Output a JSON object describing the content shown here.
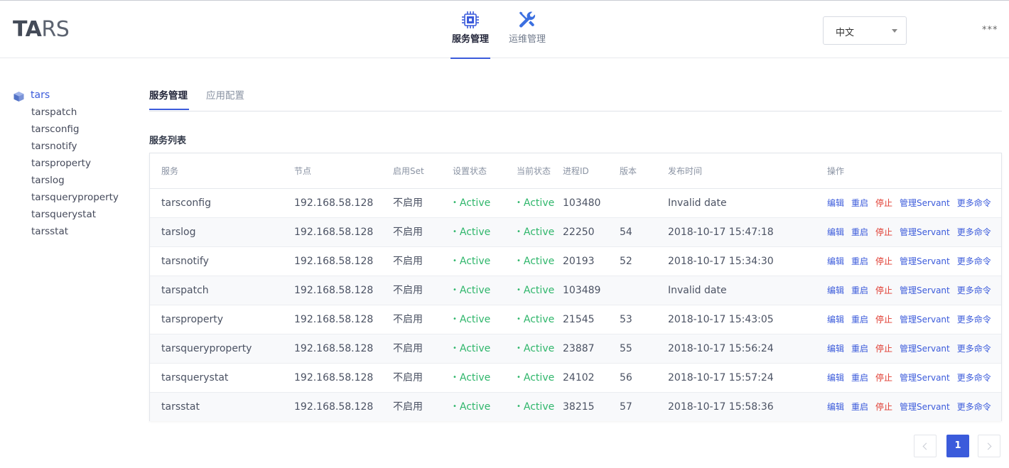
{
  "header": {
    "logo_bold": "TA",
    "logo_light": "RS",
    "nav": [
      {
        "label": "服务管理",
        "icon": "chip-icon",
        "active": true
      },
      {
        "label": "运维管理",
        "icon": "wrench-icon",
        "active": false
      }
    ],
    "language": {
      "selected": "中文"
    },
    "user_menu": "***"
  },
  "sidebar": {
    "root": {
      "label": "tars",
      "icon": "cube-icon"
    },
    "items": [
      "tarspatch",
      "tarsconfig",
      "tarsnotify",
      "tarsproperty",
      "tarslog",
      "tarsqueryproperty",
      "tarsquerystat",
      "tarsstat"
    ]
  },
  "tabs": [
    {
      "label": "服务管理",
      "active": true
    },
    {
      "label": "应用配置",
      "active": false
    }
  ],
  "section_title": "服务列表",
  "table": {
    "columns": [
      "服务",
      "节点",
      "启用Set",
      "设置状态",
      "当前状态",
      "进程ID",
      "版本",
      "发布时间",
      "操作"
    ],
    "rows": [
      {
        "service": "tarsconfig",
        "node": "192.168.58.128",
        "set": "不启用",
        "setting_state": "Active",
        "present_state": "Active",
        "pid": "103480",
        "version": "",
        "release_time": "Invalid date"
      },
      {
        "service": "tarslog",
        "node": "192.168.58.128",
        "set": "不启用",
        "setting_state": "Active",
        "present_state": "Active",
        "pid": "22250",
        "version": "54",
        "release_time": "2018-10-17 15:47:18"
      },
      {
        "service": "tarsnotify",
        "node": "192.168.58.128",
        "set": "不启用",
        "setting_state": "Active",
        "present_state": "Active",
        "pid": "20193",
        "version": "52",
        "release_time": "2018-10-17 15:34:30"
      },
      {
        "service": "tarspatch",
        "node": "192.168.58.128",
        "set": "不启用",
        "setting_state": "Active",
        "present_state": "Active",
        "pid": "103489",
        "version": "",
        "release_time": "Invalid date"
      },
      {
        "service": "tarsproperty",
        "node": "192.168.58.128",
        "set": "不启用",
        "setting_state": "Active",
        "present_state": "Active",
        "pid": "21545",
        "version": "53",
        "release_time": "2018-10-17 15:43:05"
      },
      {
        "service": "tarsqueryproperty",
        "node": "192.168.58.128",
        "set": "不启用",
        "setting_state": "Active",
        "present_state": "Active",
        "pid": "23887",
        "version": "55",
        "release_time": "2018-10-17 15:56:24"
      },
      {
        "service": "tarsquerystat",
        "node": "192.168.58.128",
        "set": "不启用",
        "setting_state": "Active",
        "present_state": "Active",
        "pid": "24102",
        "version": "56",
        "release_time": "2018-10-17 15:57:24"
      },
      {
        "service": "tarsstat",
        "node": "192.168.58.128",
        "set": "不启用",
        "setting_state": "Active",
        "present_state": "Active",
        "pid": "38215",
        "version": "57",
        "release_time": "2018-10-17 15:58:36"
      }
    ],
    "status_dot": "•",
    "row_actions": [
      "编辑",
      "重启",
      "停止",
      "管理Servant",
      "更多命令"
    ]
  },
  "pagination": {
    "current": "1"
  },
  "colors": {
    "accent": "#3b5bdb",
    "active_green": "#2fb66b",
    "danger_red": "#e03c31"
  }
}
